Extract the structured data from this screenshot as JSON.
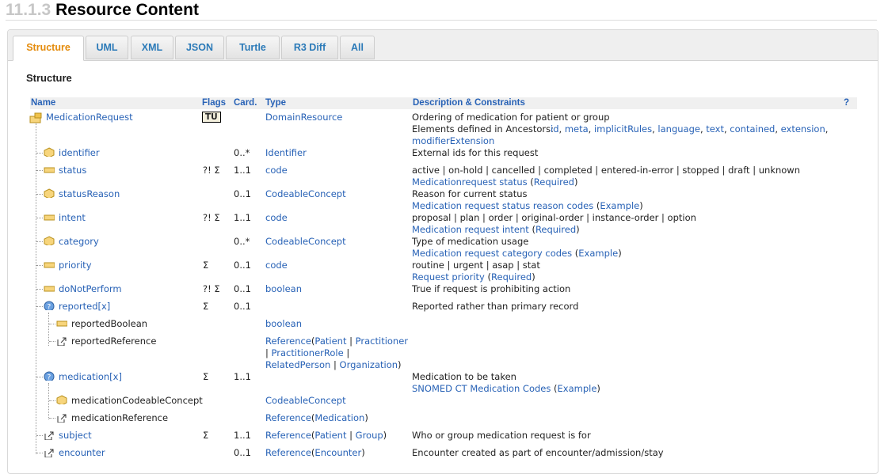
{
  "header": {
    "section_number": "11.1.3",
    "title": "Resource Content"
  },
  "tabs": [
    {
      "label": "Structure",
      "active": true
    },
    {
      "label": "UML",
      "active": false
    },
    {
      "label": "XML",
      "active": false
    },
    {
      "label": "JSON",
      "active": false
    },
    {
      "label": "Turtle",
      "active": false
    },
    {
      "label": "R3 Diff",
      "active": false
    },
    {
      "label": "All",
      "active": false
    }
  ],
  "section_title": "Structure",
  "columns": {
    "name": "Name",
    "flags": "Flags",
    "card": "Card.",
    "type": "Type",
    "desc": "Description & Constraints",
    "help": "?"
  },
  "root": {
    "name": "MedicationRequest",
    "flag": "TU",
    "type": "DomainResource",
    "desc1": "Ordering of medication for patient or group",
    "ancestors_label": "Elements defined in Ancestors:",
    "ancestors": [
      "id",
      "meta",
      "implicitRules",
      "language",
      "text",
      "contained",
      "extension",
      "modifierExtension"
    ]
  },
  "rows": {
    "identifier": {
      "name": "identifier",
      "card": "0..*",
      "type": "Identifier",
      "desc": "External ids for this request"
    },
    "status": {
      "name": "status",
      "flags": "?! Σ",
      "card": "1..1",
      "type": "code",
      "desc": "active | on-hold | cancelled | completed | entered-in-error | stopped | draft | unknown",
      "binding": "Medicationrequest status",
      "strength": "Required"
    },
    "statusReason": {
      "name": "statusReason",
      "card": "0..1",
      "type": "CodeableConcept",
      "desc": "Reason for current status",
      "binding": "Medication request status reason codes",
      "strength": "Example"
    },
    "intent": {
      "name": "intent",
      "flags": "?! Σ",
      "card": "1..1",
      "type": "code",
      "desc": "proposal | plan | order | original-order | instance-order | option",
      "binding": "Medication request intent",
      "strength": "Required"
    },
    "category": {
      "name": "category",
      "card": "0..*",
      "type": "CodeableConcept",
      "desc": "Type of medication usage",
      "binding": "Medication request category codes",
      "strength": "Example"
    },
    "priority": {
      "name": "priority",
      "flags": "Σ",
      "card": "0..1",
      "type": "code",
      "desc": "routine | urgent | asap | stat",
      "binding": "Request priority",
      "strength": "Required"
    },
    "doNotPerform": {
      "name": "doNotPerform",
      "flags": "?! Σ",
      "card": "0..1",
      "type": "boolean",
      "desc": "True if request is prohibiting action"
    },
    "reported": {
      "name": "reported[x]",
      "flags": "Σ",
      "card": "0..1",
      "desc": "Reported rather than primary record"
    },
    "reportedBoolean": {
      "name": "reportedBoolean",
      "type": "boolean"
    },
    "reportedReference": {
      "name": "reportedReference",
      "type_ref": "Reference",
      "targets": [
        "Patient",
        "Practitioner",
        "PractitionerRole",
        "RelatedPerson",
        "Organization"
      ]
    },
    "medication": {
      "name": "medication[x]",
      "flags": "Σ",
      "card": "1..1",
      "desc": "Medication to be taken",
      "binding": "SNOMED CT Medication Codes",
      "strength": "Example"
    },
    "medicationCodeableConcept": {
      "name": "medicationCodeableConcept",
      "type": "CodeableConcept"
    },
    "medicationReference": {
      "name": "medicationReference",
      "type_ref": "Reference",
      "target": "Medication"
    },
    "subject": {
      "name": "subject",
      "flags": "Σ",
      "card": "1..1",
      "type_ref": "Reference",
      "targets": [
        "Patient",
        "Group"
      ],
      "desc": "Who or group medication request is for"
    },
    "encounter": {
      "name": "encounter",
      "card": "0..1",
      "type_ref": "Reference",
      "target": "Encounter",
      "desc": "Encounter created as part of encounter/admission/stay"
    }
  },
  "punct": {
    "open": "(",
    "close": ")",
    "sep": " | ",
    "comma": ", "
  }
}
